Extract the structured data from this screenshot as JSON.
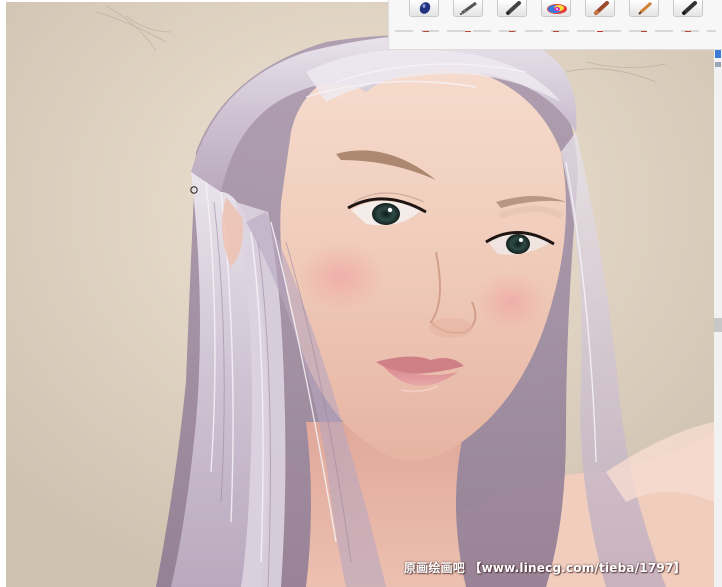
{
  "app": {
    "accent": "#3d7ad8",
    "canvas_background": "#dccdbb"
  },
  "brush_toolbar": {
    "tools": [
      {
        "name": "blue-paint-tube-icon",
        "color": "#2a3a8a"
      },
      {
        "name": "airbrush-icon",
        "color": "#4a4a4a"
      },
      {
        "name": "marker-icon",
        "color": "#444444"
      },
      {
        "name": "color-wheel-icon",
        "color": "#d020c0"
      },
      {
        "name": "oil-brush-icon",
        "color": "#b0502a"
      },
      {
        "name": "pencil-icon",
        "color": "#d08030"
      },
      {
        "name": "felt-pen-icon",
        "color": "#333333"
      }
    ]
  },
  "canvas": {
    "subject": "painting"
  },
  "watermark": {
    "text": "原画绘画吧 【www.linecg.com/tieba/1797】"
  }
}
